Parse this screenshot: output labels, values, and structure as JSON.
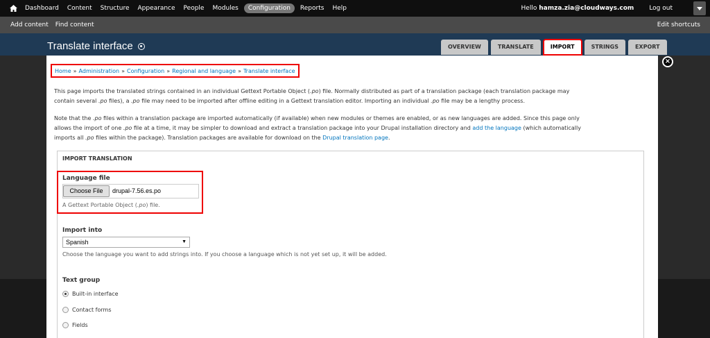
{
  "toolbar": {
    "items": [
      "Dashboard",
      "Content",
      "Structure",
      "Appearance",
      "People",
      "Modules",
      "Configuration",
      "Reports",
      "Help"
    ],
    "active_item": "Configuration",
    "hello_prefix": "Hello",
    "username": "hamza.zia@cloudways.com",
    "logout": "Log out"
  },
  "shortcuts": {
    "add_content": "Add content",
    "find_content": "Find content",
    "edit_shortcuts": "Edit shortcuts"
  },
  "page": {
    "title": "Translate interface",
    "tabs": [
      "OVERVIEW",
      "TRANSLATE",
      "IMPORT",
      "STRINGS",
      "EXPORT"
    ],
    "active_tab": "IMPORT"
  },
  "breadcrumb": {
    "items": [
      "Home",
      "Administration",
      "Configuration",
      "Regional and language",
      "Translate interface"
    ],
    "separator": "»"
  },
  "intro": {
    "p1_a": "This page imports the translated strings contained in an individual Gettext Portable Object (",
    "po": ".po",
    "p1_b": ") file. Normally distributed as part of a translation package (each translation package may",
    "p1_c": "contain several ",
    "p1_d": " files), a ",
    "p1_e": " file may need to be imported after offline editing in a Gettext translation editor. Importing an individual ",
    "p1_f": " file may be a lengthy process.",
    "p2_a": "Note that the ",
    "p2_b": " files within a translation package are imported automatically (if available) when new modules or themes are enabled, or as new languages are added. Since this page only",
    "p2_c": "allows the import of one ",
    "p2_d": " file at a time, it may be simpler to download and extract a translation package into your Drupal installation directory and ",
    "add_language_link": "add the language",
    "p2_e": " (which automatically",
    "p2_f": "imports all ",
    "p2_g": " files within the package). Translation packages are available for download on the ",
    "drupal_link": "Drupal translation page",
    "p2_h": "."
  },
  "form": {
    "legend": "IMPORT TRANSLATION",
    "language_file_label": "Language file",
    "choose_file_button": "Choose File",
    "file_name": "drupal-7.56.es.po",
    "file_desc_a": "A Gettext Portable Object (",
    "file_desc_b": ") file.",
    "import_into_label": "Import into",
    "import_into_value": "Spanish",
    "import_into_desc": "Choose the language you want to add strings into. If you choose a language which is not yet set up, it will be added.",
    "text_group_label": "Text group",
    "text_group_options": [
      "Built-in interface",
      "Contact forms",
      "Fields"
    ],
    "text_group_selected": "Built-in interface"
  }
}
